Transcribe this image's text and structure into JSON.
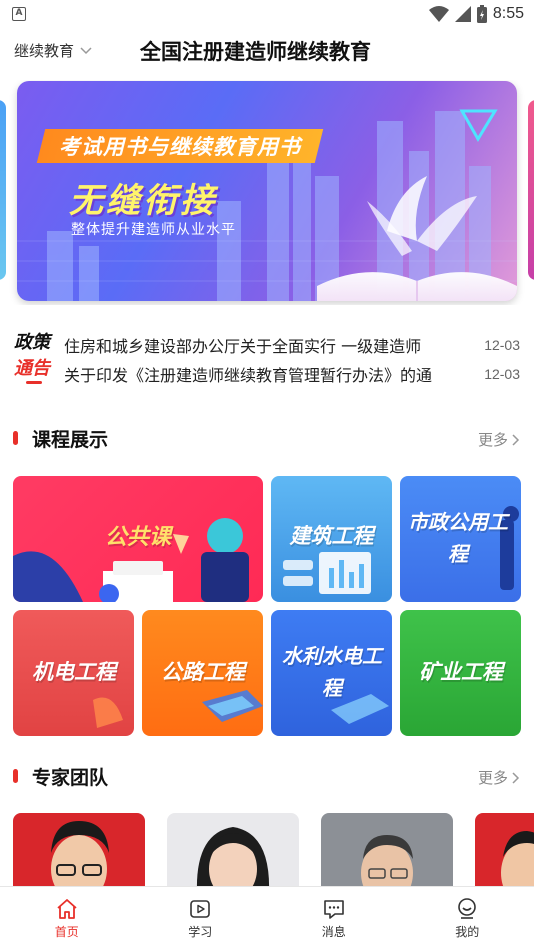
{
  "status_bar": {
    "time": "8:55",
    "notification_icon": "A",
    "battery_icon": "battery-charging-icon"
  },
  "header": {
    "category": "继续教育",
    "title": "全国注册建造师继续教育"
  },
  "banner": {
    "tag": "考试用书与继续教育用书",
    "headline": "无缝衔接",
    "subtitle": "整体提升建造师从业水平"
  },
  "notices": {
    "label_line1": "政策",
    "label_line2": "通告",
    "items": [
      {
        "text": "住房和城乡建设部办公厅关于全面实行 一级建造师",
        "date": "12-03"
      },
      {
        "text": "关于印发《注册建造师继续教育管理暂行办法》的通",
        "date": "12-03"
      }
    ]
  },
  "courses": {
    "title": "课程展示",
    "more": "更多",
    "items": [
      {
        "label": "公共课"
      },
      {
        "label": "建筑工程"
      },
      {
        "label": "市政公用工程"
      },
      {
        "label": "机电工程"
      },
      {
        "label": "公路工程"
      },
      {
        "label": "水利水电工程"
      },
      {
        "label": "矿业工程"
      }
    ]
  },
  "experts": {
    "title": "专家团队",
    "more": "更多"
  },
  "bottom_nav": [
    {
      "label": "首页",
      "icon": "home-icon",
      "active": true
    },
    {
      "label": "学习",
      "icon": "play-icon",
      "active": false
    },
    {
      "label": "消息",
      "icon": "message-icon",
      "active": false
    },
    {
      "label": "我的",
      "icon": "profile-icon",
      "active": false
    }
  ],
  "colors": {
    "accent": "#e8302a"
  }
}
